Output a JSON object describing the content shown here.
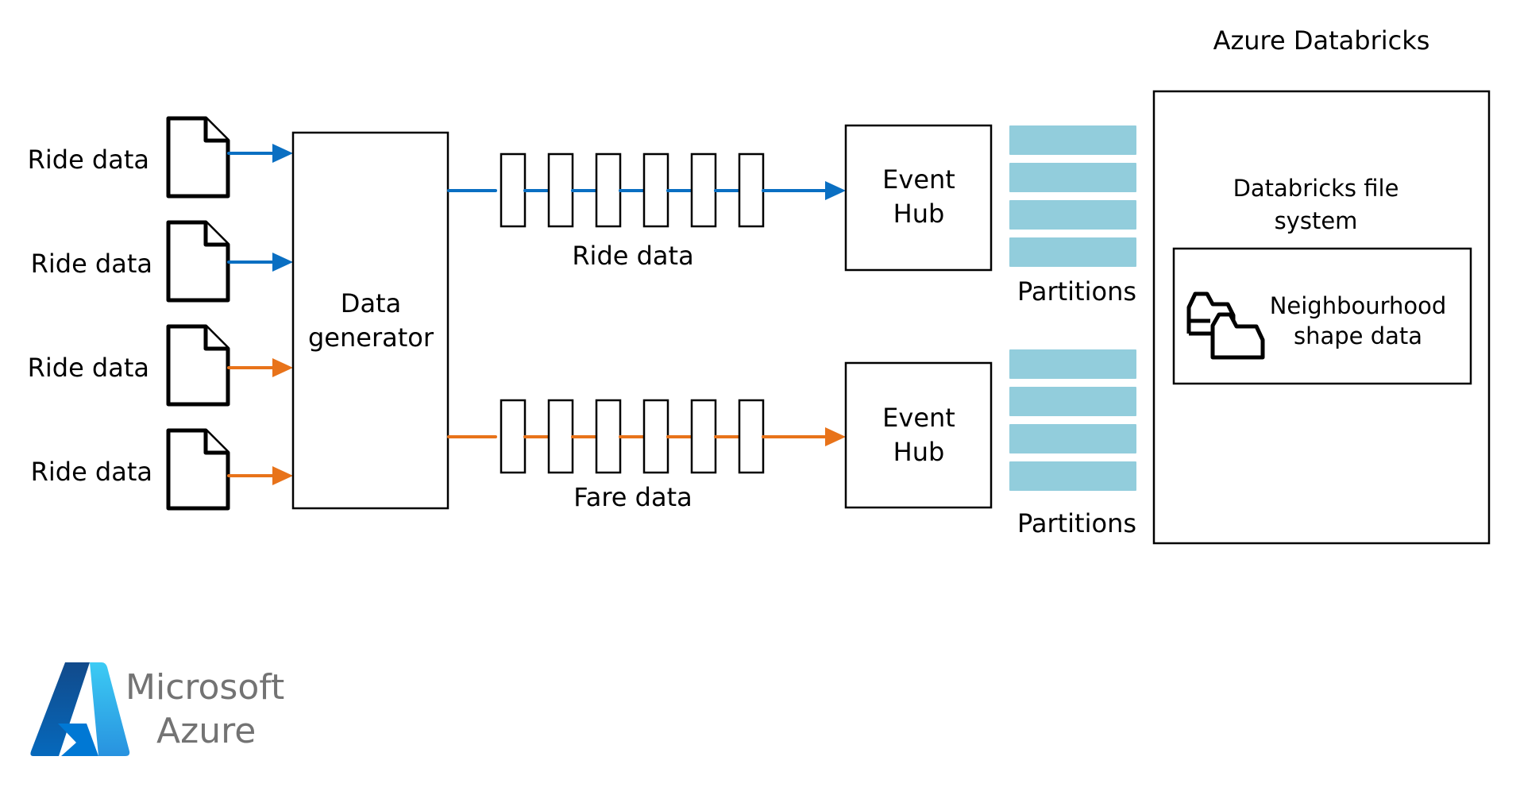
{
  "colors": {
    "ride_stream": "#0A6FC2",
    "fare_stream": "#E8731A",
    "partition": "#92CDDC",
    "brand_text": "#737373"
  },
  "sources": [
    {
      "label": "Ride data",
      "icon": "document-icon",
      "stream": "ride"
    },
    {
      "label": "Ride data",
      "icon": "document-icon",
      "stream": "ride"
    },
    {
      "label": "Ride data",
      "icon": "document-icon",
      "stream": "fare"
    },
    {
      "label": "Ride data",
      "icon": "document-icon",
      "stream": "fare"
    }
  ],
  "generator": {
    "line1": "Data",
    "line2": "generator"
  },
  "streams": [
    {
      "label": "Ride data",
      "queue_items": 6,
      "stream": "ride"
    },
    {
      "label": "Fare data",
      "queue_items": 6,
      "stream": "fare"
    }
  ],
  "event_hubs": [
    {
      "line1": "Event",
      "line2": "Hub",
      "partitions": 4,
      "partitions_label": "Partitions"
    },
    {
      "line1": "Event",
      "line2": "Hub",
      "partitions": 4,
      "partitions_label": "Partitions"
    }
  ],
  "databricks": {
    "title": "Azure Databricks",
    "dbfs_line1": "Databricks file",
    "dbfs_line2": "system",
    "shape_line1": "Neighbourhood",
    "shape_line2": "shape data",
    "shape_icon": "shapes-icon"
  },
  "brand": {
    "line1": "Microsoft",
    "line2": "Azure",
    "icon": "azure-logo-icon"
  }
}
